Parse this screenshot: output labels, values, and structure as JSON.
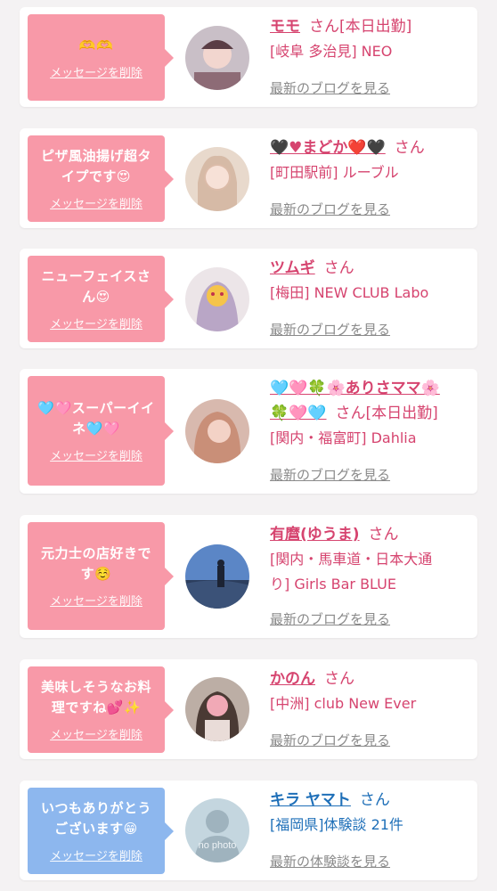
{
  "colors": {
    "pink_bubble": "#f899a8",
    "blue_bubble": "#8db7ee",
    "pink_text": "#d6446f",
    "blue_text": "#1e6fb8",
    "link_gray": "#8a8a8a"
  },
  "items": [
    {
      "message": "🫶🫶",
      "delete_label": "メッセージを削除",
      "name": "モモ",
      "honorific": "さん",
      "status": "[本日出勤]",
      "detail": "[岐阜 多治見] NEO",
      "link": "最新のブログを見る",
      "avatar": "photo-avatar"
    },
    {
      "message": "ピザ風油揚げ超タイプです😍",
      "delete_label": "メッセージを削除",
      "name": "🖤♥まどか❤️🖤",
      "honorific": "さん",
      "status": "",
      "detail": "[町田駅前] ルーブル",
      "link": "最新のブログを見る",
      "avatar": "photo-avatar"
    },
    {
      "message": "ニューフェイスさん😍",
      "delete_label": "メッセージを削除",
      "name": "ツムギ",
      "honorific": "さん",
      "status": "",
      "detail": "[梅田] NEW CLUB Labo",
      "link": "最新のブログを見る",
      "avatar": "photo-avatar"
    },
    {
      "message": "🩵🩷スーパーイイネ🩵🩷",
      "delete_label": "メッセージを削除",
      "name_line1": "🩵🩷🍀🌸ありさママ🌸",
      "name_line2": "🍀🩷🩵",
      "honorific": "さん",
      "status": "[本日出勤]",
      "detail": "[関内・福富町] Dahlia",
      "link": "最新のブログを見る",
      "avatar": "photo-avatar"
    },
    {
      "message": "元力士の店好きです☺️",
      "delete_label": "メッセージを削除",
      "name": "有麿(ゆうま)",
      "honorific": "さん",
      "status": "",
      "detail_line1": "[関内・馬車道・日本大通",
      "detail_line2": "り] Girls Bar BLUE",
      "link": "最新のブログを見る",
      "avatar": "photo-avatar"
    },
    {
      "message": "美味しそうなお料理ですね💕✨",
      "delete_label": "メッセージを削除",
      "name": "かのん",
      "honorific": "さん",
      "status": "",
      "detail": "[中洲] club New Ever",
      "link": "最新のブログを見る",
      "avatar": "photo-avatar"
    },
    {
      "message": "いつもありがとうございます😁",
      "delete_label": "メッセージを削除",
      "name": "キラ ヤマト",
      "honorific": "さん",
      "status": "",
      "detail": "[福岡県]体験談 21件",
      "link": "最新の体験談を見る",
      "avatar": "no-photo-avatar",
      "avatar_text": "no photo"
    }
  ]
}
